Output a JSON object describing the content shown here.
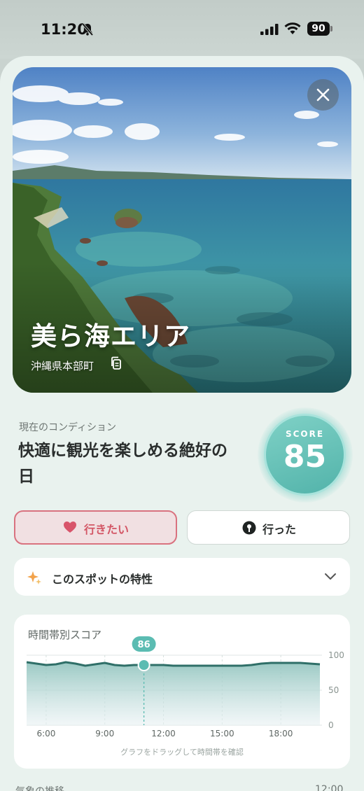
{
  "status_bar": {
    "time": "11:20",
    "battery": "90"
  },
  "spot": {
    "name": "美ら海エリア",
    "location": "沖縄県本部町"
  },
  "condition": {
    "label": "現在のコンディション",
    "title": "快適に観光を楽しめる絶好の日",
    "score_label": "SCORE",
    "score": "85"
  },
  "actions": {
    "want_label": "行きたい",
    "went_label": "行った"
  },
  "features": {
    "label": "このスポットの特性"
  },
  "chart_data": {
    "type": "area",
    "title": "時間帯別スコア",
    "x_ticks": [
      "6:00",
      "9:00",
      "12:00",
      "15:00",
      "18:00"
    ],
    "y_ticks": [
      "100",
      "50",
      "0"
    ],
    "ylim": [
      0,
      100
    ],
    "xlim": [
      5,
      20
    ],
    "x": [
      5,
      5.5,
      6,
      6.5,
      7,
      7.5,
      8,
      8.5,
      9,
      9.5,
      10,
      10.5,
      11,
      11.5,
      12,
      12.5,
      13,
      13.5,
      14,
      14.5,
      15,
      15.5,
      16,
      16.5,
      17,
      17.5,
      18,
      18.5,
      19,
      19.5,
      20
    ],
    "values": [
      90,
      88,
      86,
      87,
      90,
      88,
      85,
      87,
      89,
      86,
      85,
      86,
      86,
      86,
      86,
      85,
      85,
      85,
      85,
      85,
      85,
      85,
      85,
      86,
      88,
      89,
      89,
      89,
      89,
      88,
      87
    ],
    "selected": {
      "x": 11,
      "value": "86"
    },
    "hint": "グラフをドラッグして時間帯を確認"
  },
  "next_section": {
    "label": "气象の推移",
    "time": "12:00"
  },
  "colors": {
    "accent": "#5bbcb2",
    "line": "#2f6f68",
    "want": "#d35665"
  }
}
